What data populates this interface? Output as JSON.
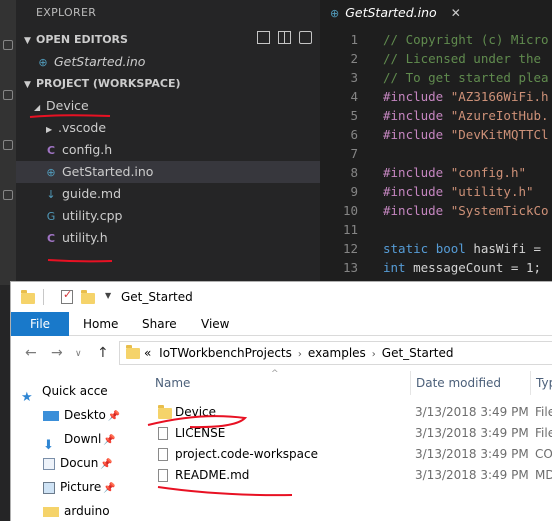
{
  "vscode": {
    "explorer_header": "EXPLORER",
    "open_editors_title": "OPEN EDITORS",
    "open_editors_items": [
      {
        "name": "GetStarted.ino",
        "icon": "arduino-file-icon"
      }
    ],
    "project_title": "PROJECT (WORKSPACE)",
    "tree": [
      {
        "name": "Device",
        "icon": "folder-open-chevron",
        "expanded": true,
        "depth": 0
      },
      {
        "name": ".vscode",
        "icon": "folder-chevron",
        "expanded": false,
        "depth": 1
      },
      {
        "name": "config.h",
        "icon": "c-icon",
        "depth": 1
      },
      {
        "name": "GetStarted.ino",
        "icon": "arduino-file-icon",
        "depth": 1,
        "selected": true
      },
      {
        "name": "guide.md",
        "icon": "markdown-icon",
        "depth": 1
      },
      {
        "name": "utility.cpp",
        "icon": "cpp-icon",
        "depth": 1
      },
      {
        "name": "utility.h",
        "icon": "c-icon",
        "depth": 1
      }
    ],
    "editor": {
      "tab_label": "GetStarted.ino",
      "lines": [
        {
          "num": "1",
          "text": "// Copyright (c) Micro"
        },
        {
          "num": "2",
          "text": "// Licensed under the "
        },
        {
          "num": "3",
          "text": "// To get started plea"
        },
        {
          "num": "4",
          "text": "#include \"AZ3166WiFi.h"
        },
        {
          "num": "5",
          "text": "#include \"AzureIotHub."
        },
        {
          "num": "6",
          "text": "#include \"DevKitMQTTCl"
        },
        {
          "num": "7",
          "text": ""
        },
        {
          "num": "8",
          "text": "#include \"config.h\""
        },
        {
          "num": "9",
          "text": "#include \"utility.h\""
        },
        {
          "num": "10",
          "text": "#include \"SystemTickCo"
        },
        {
          "num": "11",
          "text": ""
        },
        {
          "num": "12",
          "text": "static bool hasWifi = "
        },
        {
          "num": "13",
          "text": "int messageCount = 1;"
        }
      ]
    }
  },
  "file_explorer": {
    "window_title": "Get_Started",
    "ribbon_tabs": [
      "File",
      "Home",
      "Share",
      "View"
    ],
    "breadcrumb": [
      "«",
      "IoTWorkbenchProjects",
      "examples",
      "Get_Started"
    ],
    "nav_pane": [
      {
        "label": "Quick acce",
        "icon": "star-icon"
      },
      {
        "label": "Deskto",
        "icon": "desktop-icon",
        "pinned": true
      },
      {
        "label": "Downl",
        "icon": "download-icon",
        "pinned": true
      },
      {
        "label": "Docun",
        "icon": "documents-icon",
        "pinned": true
      },
      {
        "label": "Picture",
        "icon": "pictures-icon",
        "pinned": true
      },
      {
        "label": "arduino",
        "icon": "folder-icon"
      }
    ],
    "columns": {
      "name": "Name",
      "date": "Date modified",
      "type": "Typ"
    },
    "files": [
      {
        "name": "Device",
        "date": "3/13/2018 3:49 PM",
        "type": "File",
        "icon": "folder-icon"
      },
      {
        "name": "LICENSE",
        "date": "3/13/2018 3:49 PM",
        "type": "File",
        "icon": "document-icon"
      },
      {
        "name": "project.code-workspace",
        "date": "3/13/2018 3:49 PM",
        "type": "CO",
        "icon": "document-icon"
      },
      {
        "name": "README.md",
        "date": "3/13/2018 3:49 PM",
        "type": "MD",
        "icon": "document-icon"
      }
    ]
  },
  "colors": {
    "vscode_sidebar": "#252526",
    "vscode_editor": "#1e1e1e",
    "comment": "#608b4e",
    "preprocessor": "#c586c0",
    "string": "#ce9178",
    "keyword": "#569cd6",
    "file_tab_blue": "#1979ca",
    "annotation_red": "#e81123"
  }
}
